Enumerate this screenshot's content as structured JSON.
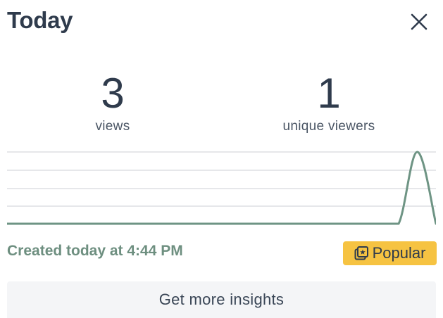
{
  "header": {
    "title": "Today",
    "close_icon": "close-icon"
  },
  "stats": {
    "views": {
      "value": "3",
      "label": "views"
    },
    "unique_viewers": {
      "value": "1",
      "label": "unique viewers"
    }
  },
  "chart_data": {
    "type": "line",
    "x": [
      0,
      1,
      2,
      3,
      4,
      5,
      6,
      7,
      8,
      9,
      10,
      11,
      12,
      13,
      14,
      15,
      16,
      17,
      18,
      19,
      20,
      21,
      22,
      23
    ],
    "series": [
      {
        "values": [
          0,
          0,
          0,
          0,
          0,
          0,
          0,
          0,
          0,
          0,
          0,
          0,
          0,
          0,
          0,
          0,
          0,
          0,
          0,
          0,
          0,
          0,
          3,
          0
        ]
      }
    ],
    "ylim": [
      0,
      3
    ],
    "grid": true,
    "line_color": "#6e9484",
    "grid_color": "#e6e7ea"
  },
  "footer": {
    "created_text": "Created today at 4:44 PM",
    "popular_label": "Popular",
    "popular_icon": "popular-badge-icon",
    "popular_color": "#f6c342",
    "insights_label": "Get more insights"
  }
}
